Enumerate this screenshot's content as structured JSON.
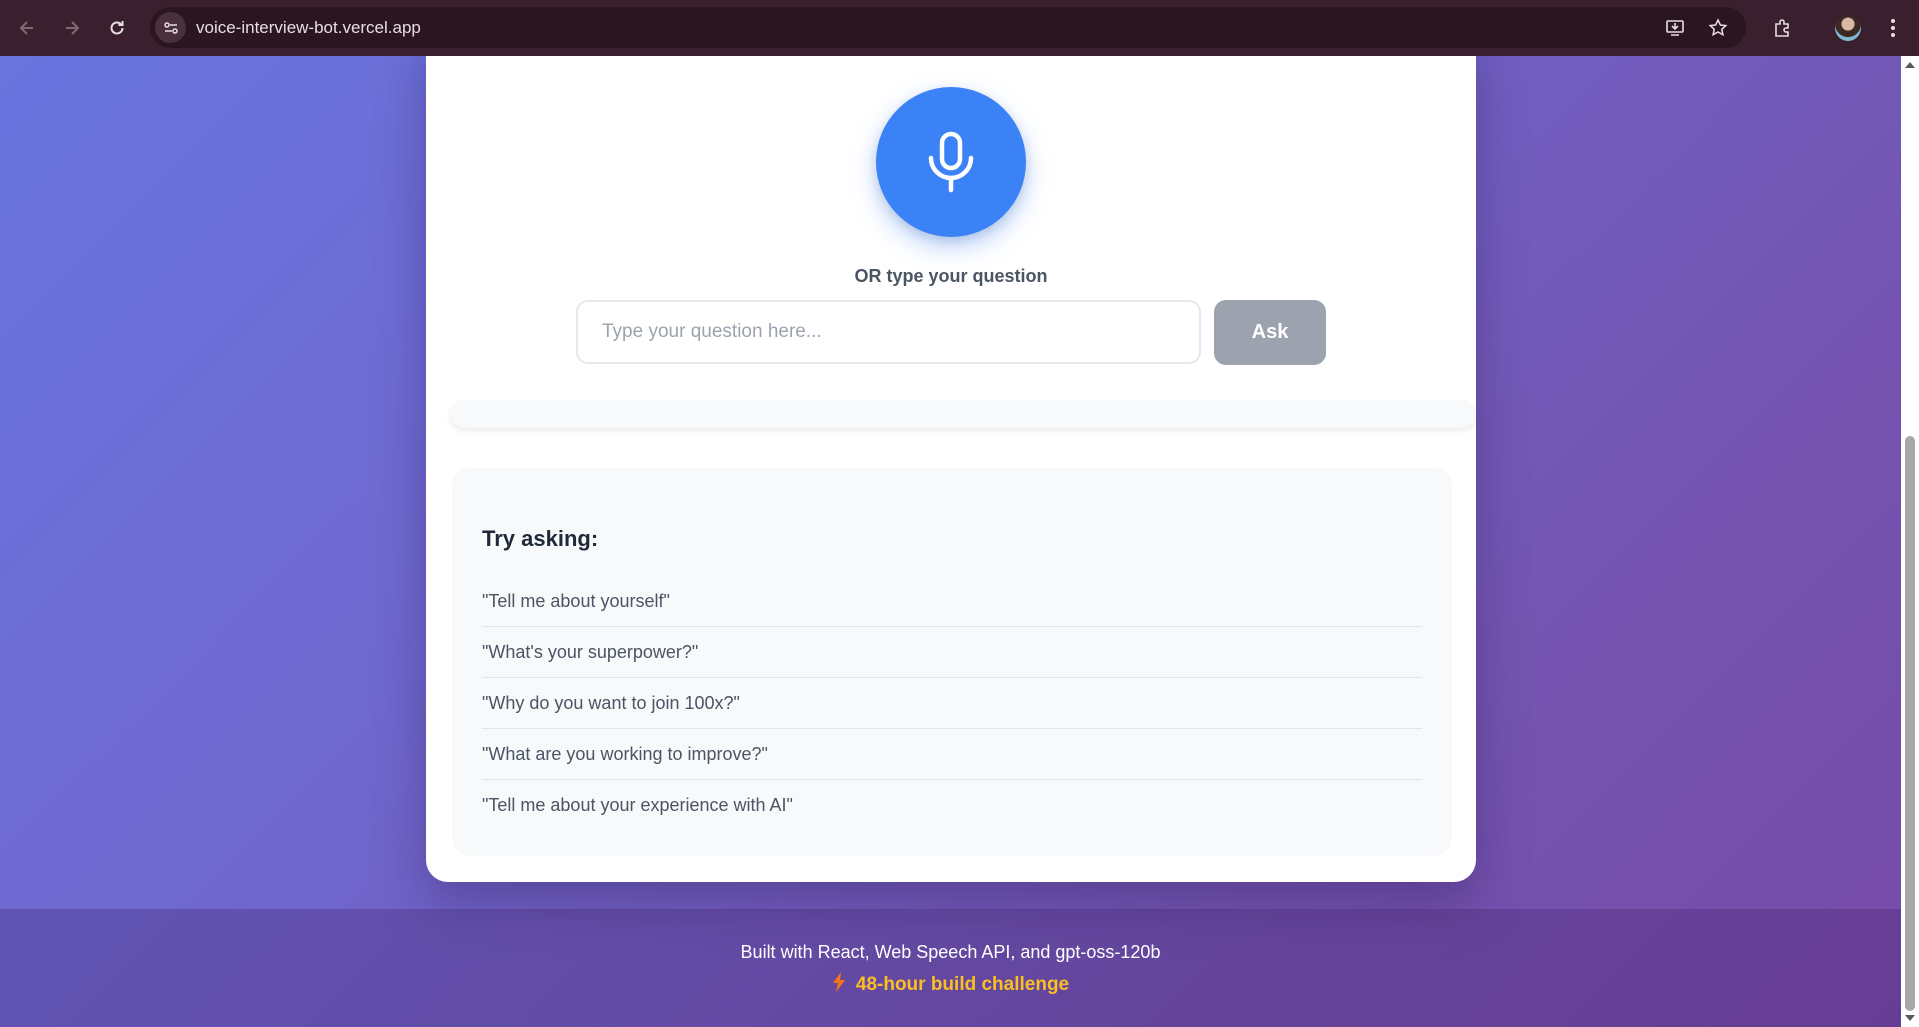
{
  "browser": {
    "url": "voice-interview-bot.vercel.app",
    "icons": [
      "back-arrow-icon",
      "forward-arrow-icon",
      "reload-icon",
      "site-info-icon",
      "install-app-icon",
      "star-icon",
      "extensions-icon",
      "profile-avatar",
      "kebab-menu-icon"
    ]
  },
  "main": {
    "or_label": "OR type your question",
    "input_placeholder": "Type your question here...",
    "input_value": "",
    "ask_label": "Ask",
    "mic_color": "#3b82f6",
    "ask_color": "#9ca3af"
  },
  "suggestions": {
    "title": "Try asking:",
    "items": [
      "\"Tell me about yourself\"",
      "\"What's your superpower?\"",
      "\"Why do you want to join 100x?\"",
      "\"What are you working to improve?\"",
      "\"Tell me about your experience with AI\""
    ]
  },
  "footer": {
    "built_with": "Built with React, Web Speech API, and gpt-oss-120b",
    "badge": "48-hour build challenge",
    "badge_color": "#fbbf24"
  }
}
